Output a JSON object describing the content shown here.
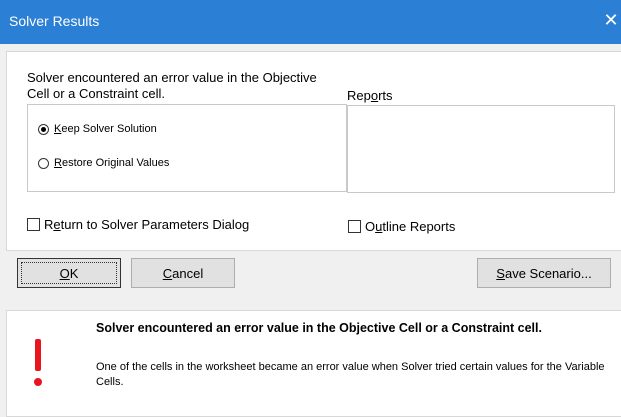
{
  "window": {
    "title": "Solver Results",
    "close_icon": "close-icon"
  },
  "main": {
    "message_line1": "Solver encountered an error value in the Objective",
    "message_line2": "Cell or a Constraint cell.",
    "options": [
      {
        "key": "K",
        "rest": "eep Solver Solution",
        "selected": true
      },
      {
        "key": "R",
        "rest": "estore Original Values",
        "selected": false
      }
    ],
    "reports_label_pre": "Rep",
    "reports_label_key": "o",
    "reports_label_post": "rts",
    "reports_items": [],
    "return_to_dialog": {
      "pre": "R",
      "key": "e",
      "post": "turn to Solver Parameters Dialog",
      "checked": false
    },
    "outline_reports": {
      "pre": "O",
      "key": "u",
      "post": "tline Reports",
      "checked": false
    }
  },
  "buttons": {
    "ok": {
      "key": "O",
      "rest": "K"
    },
    "cancel": {
      "key": "C",
      "rest": "ancel"
    },
    "save_scenario": {
      "key": "S",
      "rest": "ave Scenario..."
    }
  },
  "info": {
    "icon": "exclamation-icon",
    "icon_color": "#e8141e",
    "title": "Solver encountered an error value in the Objective Cell or a Constraint cell.",
    "body": "One of the cells in the worksheet became an error value when Solver tried certain values for the Variable Cells."
  },
  "colors": {
    "titlebar": "#2b7fd4",
    "dialog_bg": "#f0f0f0"
  }
}
